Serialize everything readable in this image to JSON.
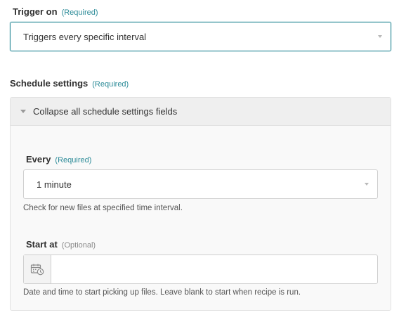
{
  "trigger": {
    "label": "Trigger on",
    "required": "(Required)",
    "value": "Triggers every specific interval"
  },
  "schedule": {
    "label": "Schedule settings",
    "required": "(Required)",
    "collapse_label": "Collapse all schedule settings fields",
    "every": {
      "label": "Every",
      "required": "(Required)",
      "value": "1 minute",
      "hint": "Check for new files at specified time interval."
    },
    "start_at": {
      "label": "Start at",
      "optional": "(Optional)",
      "value": "",
      "hint": "Date and time to start picking up files. Leave blank to start when recipe is run."
    }
  },
  "icons": {
    "dropdown": "chevron-down-icon",
    "collapse": "caret-down-icon",
    "calendar": "calendar-clock-icon"
  },
  "colors": {
    "accent": "#2a8a97",
    "panel_bg": "#f9f9f9",
    "panel_header_bg": "#efefef",
    "border": "#cfcfcf"
  }
}
